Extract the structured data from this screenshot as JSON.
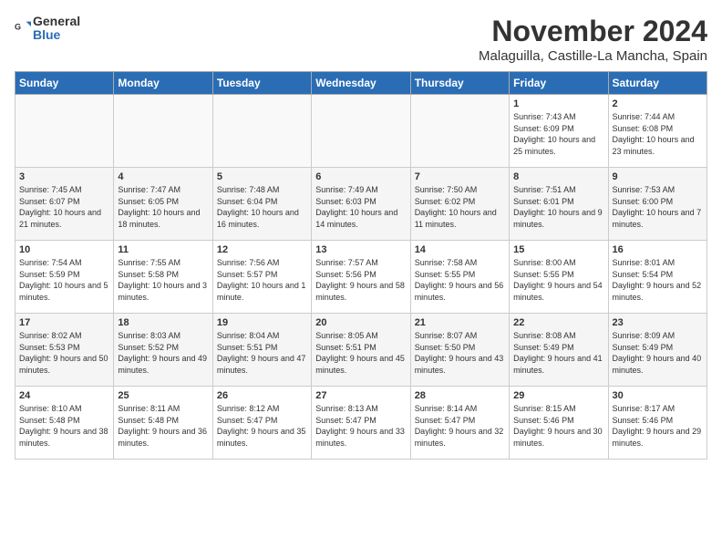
{
  "logo": {
    "general": "General",
    "blue": "Blue"
  },
  "title": "November 2024",
  "location": "Malaguilla, Castille-La Mancha, Spain",
  "headers": [
    "Sunday",
    "Monday",
    "Tuesday",
    "Wednesday",
    "Thursday",
    "Friday",
    "Saturday"
  ],
  "rows": [
    [
      {
        "day": "",
        "info": ""
      },
      {
        "day": "",
        "info": ""
      },
      {
        "day": "",
        "info": ""
      },
      {
        "day": "",
        "info": ""
      },
      {
        "day": "",
        "info": ""
      },
      {
        "day": "1",
        "info": "Sunrise: 7:43 AM\nSunset: 6:09 PM\nDaylight: 10 hours and 25 minutes."
      },
      {
        "day": "2",
        "info": "Sunrise: 7:44 AM\nSunset: 6:08 PM\nDaylight: 10 hours and 23 minutes."
      }
    ],
    [
      {
        "day": "3",
        "info": "Sunrise: 7:45 AM\nSunset: 6:07 PM\nDaylight: 10 hours and 21 minutes."
      },
      {
        "day": "4",
        "info": "Sunrise: 7:47 AM\nSunset: 6:05 PM\nDaylight: 10 hours and 18 minutes."
      },
      {
        "day": "5",
        "info": "Sunrise: 7:48 AM\nSunset: 6:04 PM\nDaylight: 10 hours and 16 minutes."
      },
      {
        "day": "6",
        "info": "Sunrise: 7:49 AM\nSunset: 6:03 PM\nDaylight: 10 hours and 14 minutes."
      },
      {
        "day": "7",
        "info": "Sunrise: 7:50 AM\nSunset: 6:02 PM\nDaylight: 10 hours and 11 minutes."
      },
      {
        "day": "8",
        "info": "Sunrise: 7:51 AM\nSunset: 6:01 PM\nDaylight: 10 hours and 9 minutes."
      },
      {
        "day": "9",
        "info": "Sunrise: 7:53 AM\nSunset: 6:00 PM\nDaylight: 10 hours and 7 minutes."
      }
    ],
    [
      {
        "day": "10",
        "info": "Sunrise: 7:54 AM\nSunset: 5:59 PM\nDaylight: 10 hours and 5 minutes."
      },
      {
        "day": "11",
        "info": "Sunrise: 7:55 AM\nSunset: 5:58 PM\nDaylight: 10 hours and 3 minutes."
      },
      {
        "day": "12",
        "info": "Sunrise: 7:56 AM\nSunset: 5:57 PM\nDaylight: 10 hours and 1 minute."
      },
      {
        "day": "13",
        "info": "Sunrise: 7:57 AM\nSunset: 5:56 PM\nDaylight: 9 hours and 58 minutes."
      },
      {
        "day": "14",
        "info": "Sunrise: 7:58 AM\nSunset: 5:55 PM\nDaylight: 9 hours and 56 minutes."
      },
      {
        "day": "15",
        "info": "Sunrise: 8:00 AM\nSunset: 5:55 PM\nDaylight: 9 hours and 54 minutes."
      },
      {
        "day": "16",
        "info": "Sunrise: 8:01 AM\nSunset: 5:54 PM\nDaylight: 9 hours and 52 minutes."
      }
    ],
    [
      {
        "day": "17",
        "info": "Sunrise: 8:02 AM\nSunset: 5:53 PM\nDaylight: 9 hours and 50 minutes."
      },
      {
        "day": "18",
        "info": "Sunrise: 8:03 AM\nSunset: 5:52 PM\nDaylight: 9 hours and 49 minutes."
      },
      {
        "day": "19",
        "info": "Sunrise: 8:04 AM\nSunset: 5:51 PM\nDaylight: 9 hours and 47 minutes."
      },
      {
        "day": "20",
        "info": "Sunrise: 8:05 AM\nSunset: 5:51 PM\nDaylight: 9 hours and 45 minutes."
      },
      {
        "day": "21",
        "info": "Sunrise: 8:07 AM\nSunset: 5:50 PM\nDaylight: 9 hours and 43 minutes."
      },
      {
        "day": "22",
        "info": "Sunrise: 8:08 AM\nSunset: 5:49 PM\nDaylight: 9 hours and 41 minutes."
      },
      {
        "day": "23",
        "info": "Sunrise: 8:09 AM\nSunset: 5:49 PM\nDaylight: 9 hours and 40 minutes."
      }
    ],
    [
      {
        "day": "24",
        "info": "Sunrise: 8:10 AM\nSunset: 5:48 PM\nDaylight: 9 hours and 38 minutes."
      },
      {
        "day": "25",
        "info": "Sunrise: 8:11 AM\nSunset: 5:48 PM\nDaylight: 9 hours and 36 minutes."
      },
      {
        "day": "26",
        "info": "Sunrise: 8:12 AM\nSunset: 5:47 PM\nDaylight: 9 hours and 35 minutes."
      },
      {
        "day": "27",
        "info": "Sunrise: 8:13 AM\nSunset: 5:47 PM\nDaylight: 9 hours and 33 minutes."
      },
      {
        "day": "28",
        "info": "Sunrise: 8:14 AM\nSunset: 5:47 PM\nDaylight: 9 hours and 32 minutes."
      },
      {
        "day": "29",
        "info": "Sunrise: 8:15 AM\nSunset: 5:46 PM\nDaylight: 9 hours and 30 minutes."
      },
      {
        "day": "30",
        "info": "Sunrise: 8:17 AM\nSunset: 5:46 PM\nDaylight: 9 hours and 29 minutes."
      }
    ]
  ]
}
